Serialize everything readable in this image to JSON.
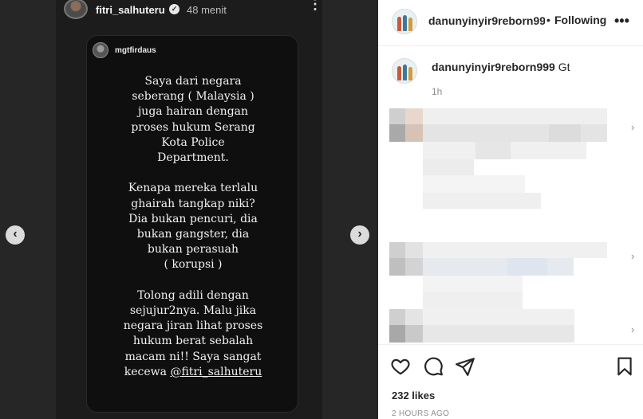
{
  "story": {
    "username": "fitri_salhuteru",
    "time": "48 menit",
    "reshared_username": "mgtfirdaus",
    "text": "Saya dari negara\nseberang ( Malaysia )\njuga hairan dengan\nproses hukum Serang\nKota Police\nDepartment.\n\nKenapa mereka terlalu\nghairah tangkap niki?\nDia bukan pencuri, dia\nbukan gangster, dia\nbukan perasuah\n( korupsi )\n\nTolong adili dengan\nsejujur2nya. Malu jika\nnegara jiran lihat proses\nhukum berat sebalah\nmacam ni!! Saya sangat\nkecewa ",
    "mention": "@fitri_salhuteru",
    "icons": {
      "verified": "verified-badge-icon",
      "more": "more-vertical-icon"
    }
  },
  "nav": {
    "prev": "‹",
    "next": "›"
  },
  "post": {
    "owner": "danunyinyir9reborn999",
    "follow_label": "Following",
    "dot": "•",
    "caption_user": "danunyinyir9reborn999",
    "caption_text": "Gt",
    "caption_time": "1h",
    "likes": "232 likes",
    "date": "2 HOURS AGO"
  },
  "colors": {
    "accent": "#262626",
    "muted": "#8e8e8e",
    "story_bg": "#1c1c1c"
  }
}
